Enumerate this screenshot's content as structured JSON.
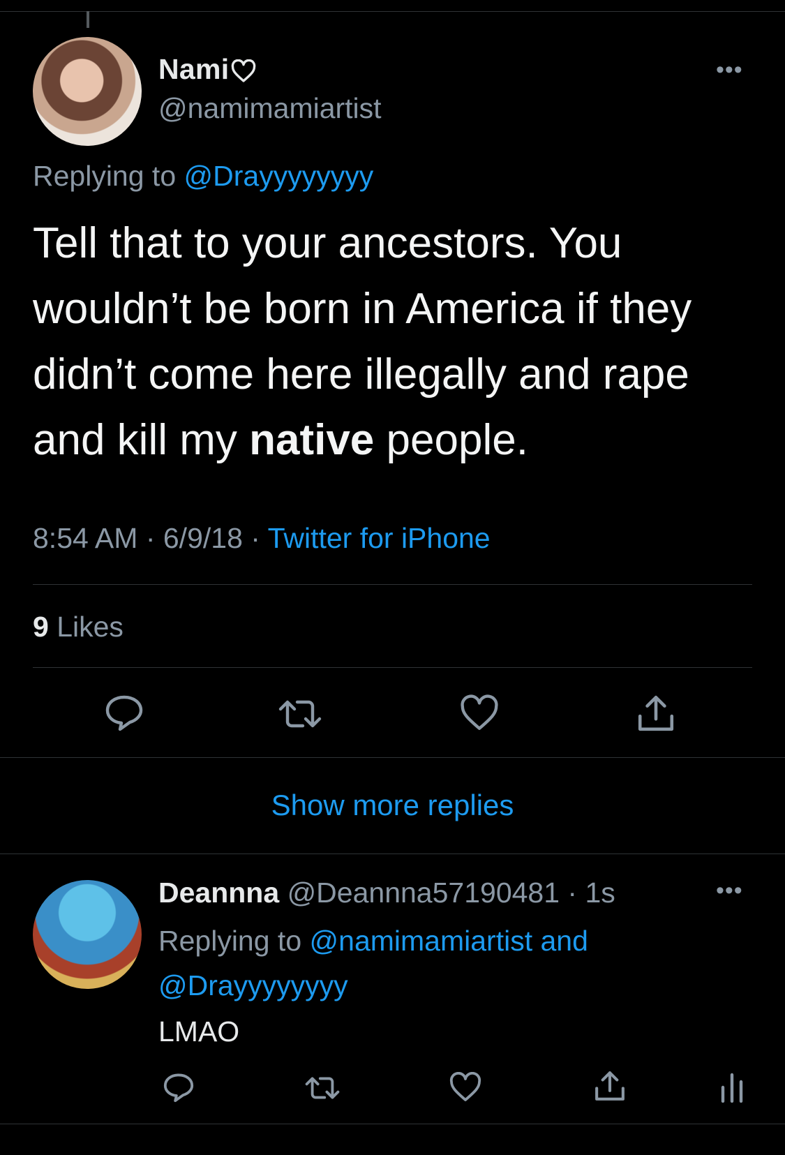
{
  "tweet": {
    "display_name": "Nami",
    "handle": "@namimamiartist",
    "replying_label": "Replying to",
    "replying_to": "@Drayyyyyyyy",
    "text_part1": "Tell that to your ancestors. You wouldn’t be born in America if they didn’t come here illegally and rape and kill my ",
    "text_bold": "native",
    "text_part2": " people.",
    "time": "8:54 AM",
    "date": "6/9/18",
    "source": "Twitter for iPhone",
    "likes_count": "9",
    "likes_label": "Likes"
  },
  "show_more": "Show more replies",
  "reply": {
    "display_name": "Deannna",
    "handle": "@Deannna57190481",
    "age": "1s",
    "replying_label": "Replying to",
    "replying_to": "@namimamiartist and @Drayyyyyyyy",
    "text": "LMAO"
  },
  "icons": {
    "actions": [
      "reply-icon",
      "retweet-icon",
      "like-icon",
      "share-icon",
      "analytics-icon"
    ],
    "more": "more-icon",
    "name_heart": "heart-outline-icon",
    "accent_color": "#1d9bf0"
  }
}
